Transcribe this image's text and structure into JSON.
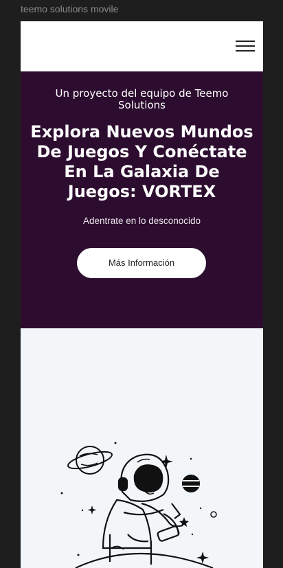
{
  "canvas": {
    "frame_label": "teemo solutions movile"
  },
  "header": {
    "menu_icon": "hamburger-menu-icon"
  },
  "hero": {
    "kicker": "Un proyecto del equipo de Teemo Solutions",
    "title": "Explora Nuevos Mundos De Juegos Y Conéctate En La Galaxia De Juegos: VORTEX",
    "subtitle": "Adentrate en lo desconocido",
    "cta_label": "Más Información",
    "background_color": "#2d0d2f"
  },
  "illustration": {
    "subject": "astronaut-illustration"
  }
}
